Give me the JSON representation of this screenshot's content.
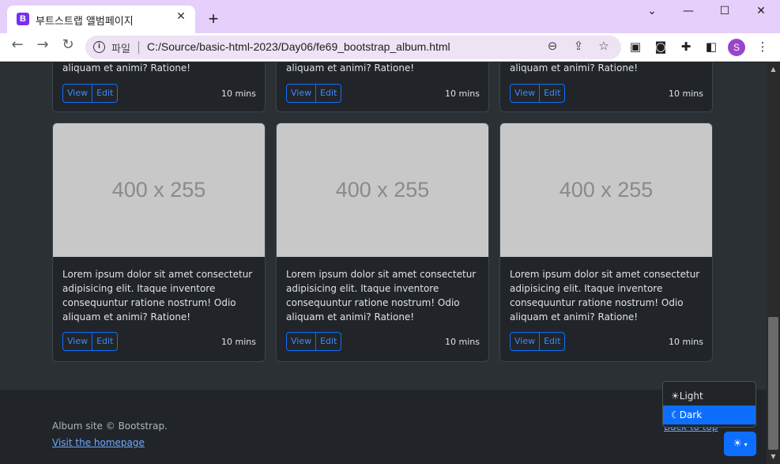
{
  "browser": {
    "tab_title": "부트스트랩 앨범페이지",
    "favicon_letter": "B",
    "new_tab": "+",
    "scheme_label": "파일",
    "url": "C:/Source/basic-html-2023/Day06/fe69_bootstrap_album.html",
    "profile_initial": "S"
  },
  "cards": {
    "snippet_last_line": "aliquam et animi? Ratione!",
    "thumb_label": "400 x 255",
    "text": "Lorem ipsum dolor sit amet consectetur adipisicing elit. Itaque inventore consequuntur ratione nostrum! Odio aliquam et animi? Ratione!",
    "view_label": "View",
    "edit_label": "Edit",
    "time": "10 mins"
  },
  "footer": {
    "copyright": "Album site © Bootstrap.",
    "homepage_link": "Visit the homepage",
    "back_to_top": "Back to top"
  },
  "theme_menu": {
    "items": [
      {
        "label": "Light",
        "icon": "sun-icon"
      },
      {
        "label": "Dark",
        "icon": "moon-icon"
      }
    ],
    "active": "Dark",
    "toggle_icon": "sun-icon"
  },
  "colors": {
    "primary": "#0d6efd",
    "body_bg": "#212529",
    "album_bg": "#2b3035",
    "titlebar": "#e6cffa"
  }
}
